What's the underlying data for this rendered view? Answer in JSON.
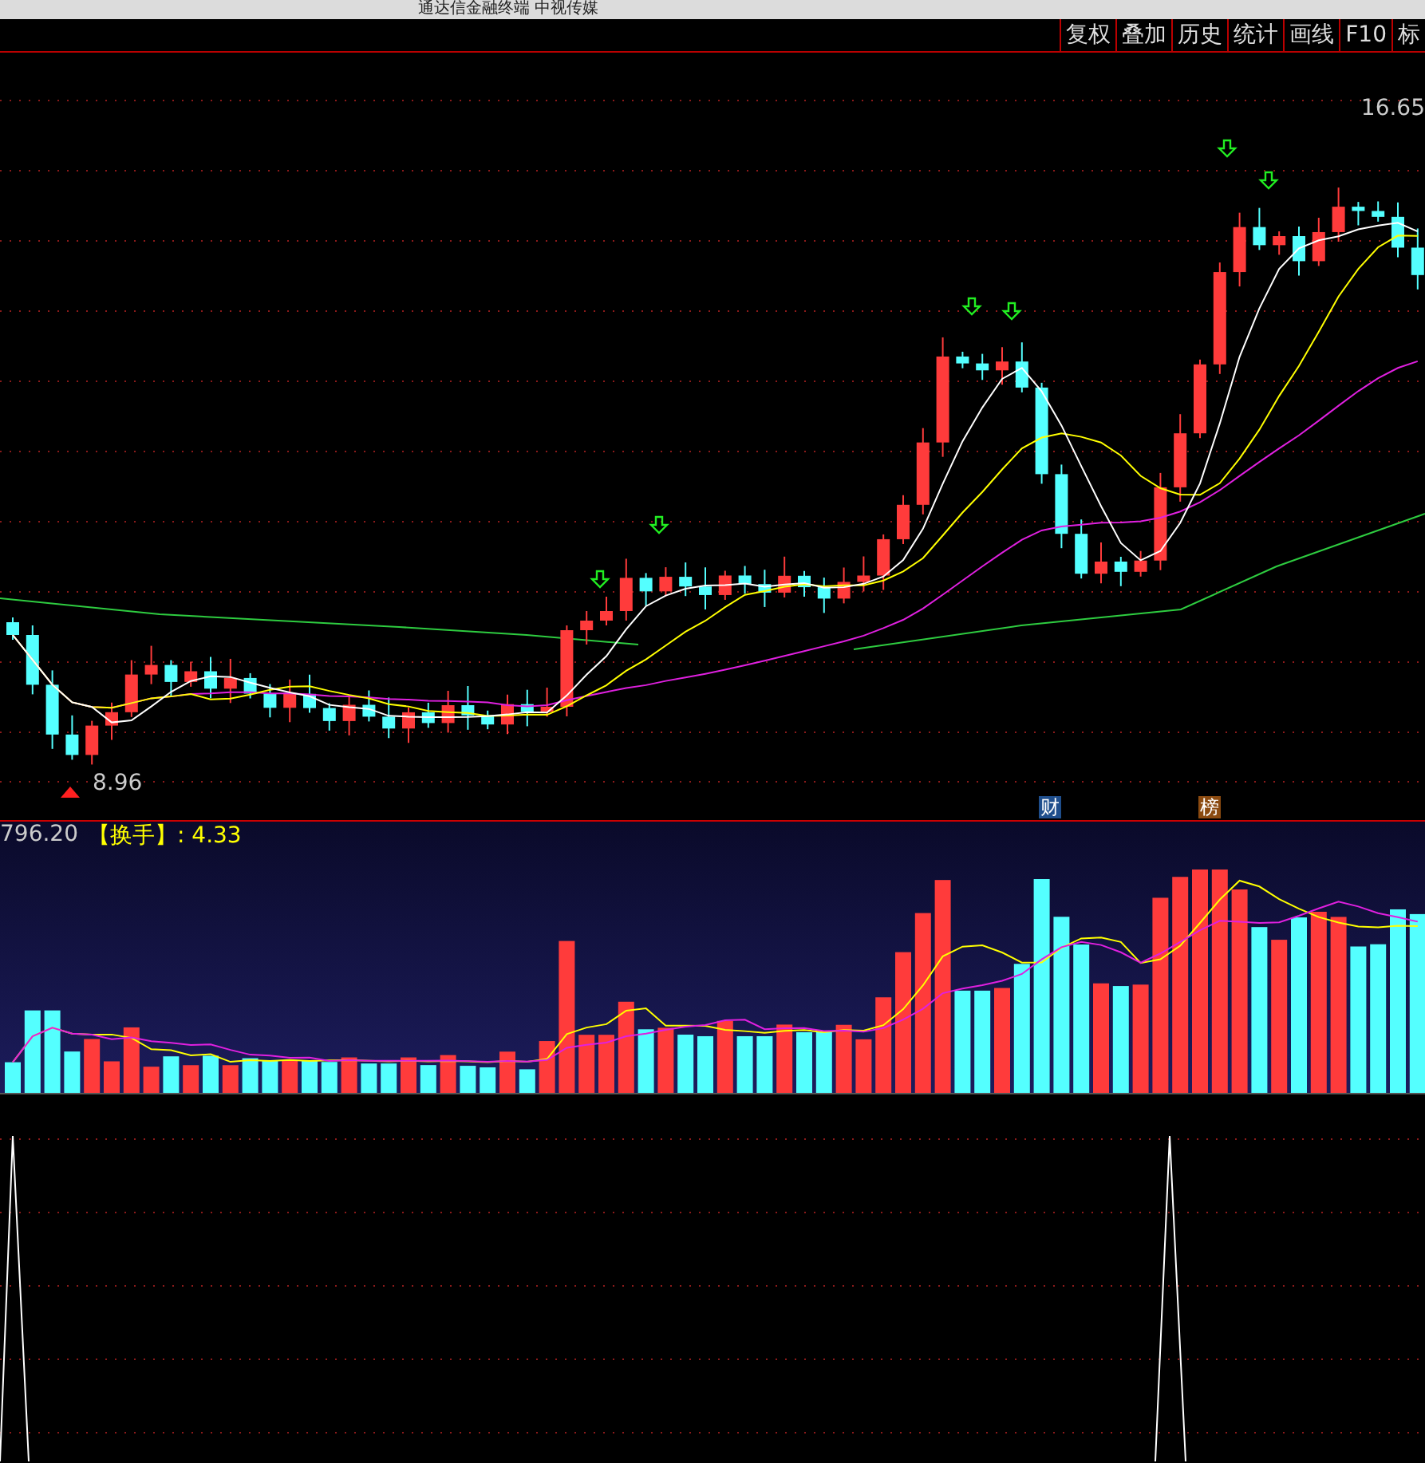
{
  "window": {
    "title": "通达信金融终端 中视传媒"
  },
  "toolbar": [
    {
      "label": "复权"
    },
    {
      "label": "叠加"
    },
    {
      "label": "历史"
    },
    {
      "label": "统计"
    },
    {
      "label": "画线"
    },
    {
      "label": "F10"
    },
    {
      "label": "标"
    }
  ],
  "price_chart": {
    "high_label": "16.65",
    "low_label": "8.96",
    "markers": [
      {
        "label": "财",
        "color": "#1f4e8c"
      },
      {
        "label": "榜",
        "color": "#8b4a10"
      }
    ]
  },
  "volume_panel": {
    "volume_reading": "796.20",
    "turnover": "【换手】: 4.33"
  }
}
